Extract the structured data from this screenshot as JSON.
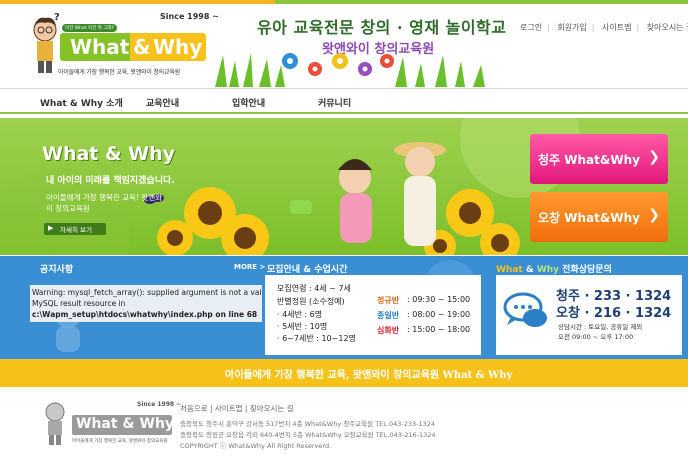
{
  "header": {
    "since": "Since 1998 ~",
    "badge": "이건 What 이건 뭐 그래?",
    "brand_what": "What",
    "brand_amp": "&",
    "brand_why": "Why",
    "tagline": "아이들에게 가장 행복한 교육, 왓앤와이 창의교육원",
    "slogan_top": "유아 교육전문 창의 · 영재 놀이학교",
    "slogan_bottom": "왓앤와이 창의교육원",
    "util_links": [
      "로그인",
      "회원가입",
      "사이트맵",
      "찾아오시는 길"
    ]
  },
  "nav": {
    "items": [
      "What & Why 소개",
      "교육안내",
      "입학안내",
      "커뮤니티"
    ]
  },
  "hero": {
    "title": "What & Why",
    "subtitle": "내 아이의 미래를 책임지겠습니다.",
    "desc": "아이들에게 가장 행복한 교육! 왓앤와이 창의교육원",
    "more_label": "자세히 보기",
    "btn_cheongju": "청주 What&Why",
    "btn_ochang": "오창 What&Why"
  },
  "notice": {
    "title": "공지사항",
    "more": "MORE >",
    "warning_line1": "Warning: mysql_fetch_array(): supplied argument is not a valid",
    "warning_line2": "MySQL result resource in",
    "warning_line3": "c:\\Wapm_setup\\htdocs\\whatwhy\\index.php on line 68"
  },
  "recruit": {
    "title": "모집안내 & 수업시간",
    "ages_label": "모집연령 : 4세 ~ 7세",
    "class_label": "반별정원 (소수정예)",
    "classes": [
      "· 4세반 : 6명",
      "· 5세반 : 10명",
      "· 6~7세반 : 10~12명"
    ],
    "schedule": [
      {
        "name": "정규반",
        "time": ": 09:30 ~ 15:00"
      },
      {
        "name": "종일반",
        "time": ": 08:00 ~ 19:00"
      },
      {
        "name": "심화반",
        "time": ": 15:00 ~ 18:00"
      }
    ]
  },
  "phone": {
    "title_what": "What",
    "title_amp": " & ",
    "title_why": "Why",
    "title_rest": " 전화상담문의",
    "cheongju": "청주 · 233 · 1324",
    "ochang": "오창 · 216 · 1324",
    "hours1": "상담시간 : 토요일, 공휴일 제외",
    "hours2": "오전 09:00 ~ 오후 17:00"
  },
  "strip": {
    "text": "아이들에게 가장 행복한 교육, 왓앤와이 창의교육원  What & Why"
  },
  "footer": {
    "since": "Since 1998 ~",
    "brand": "What & Why",
    "tagline": "아이들에게 가장 행복한 교육, 왓앤와이 창의교육원",
    "links": [
      "처음으로",
      "사이트맵",
      "찾아오시는 길"
    ],
    "addr1": "충청북도 청주시 흥덕구 강서동 517번지 4층 What&Why 청주교육원  TEL.043-233-1324",
    "addr2": "충청북도 청원군 오창읍 각리 640-4번지 5층 What&Why 오창교육원  TEL.043-216-1324",
    "copyright": "COPYRIGHT ⓒ What&Why All Right Reserverd."
  },
  "colors": {
    "green": "#8cc63f",
    "blue_band": "#3a8ed4",
    "yellow_strip": "#f6c21a",
    "pink_button": "#e2177b",
    "orange_button": "#f26d0c"
  }
}
